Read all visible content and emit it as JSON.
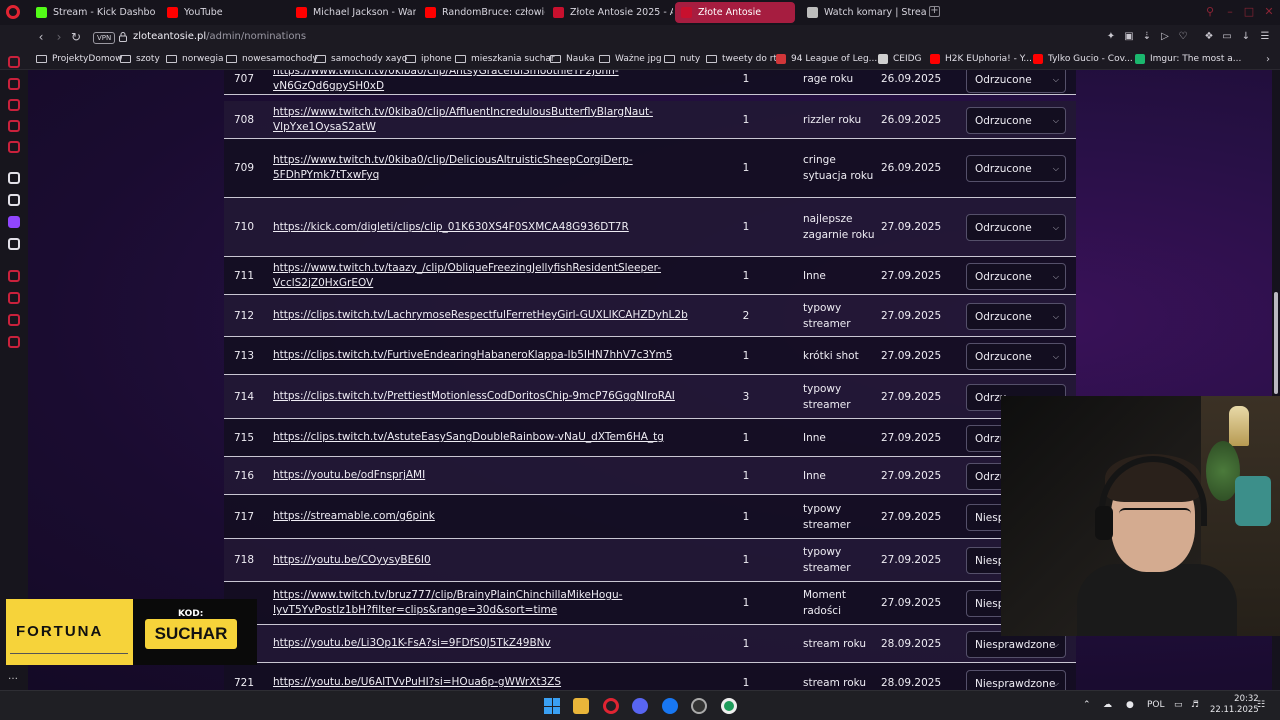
{
  "tabs": [
    {
      "label": "Stream - Kick Dashboard",
      "icon": "kick-icon",
      "color": "#53fc18",
      "active": false
    },
    {
      "label": "YouTube",
      "icon": "youtube-icon",
      "color": "#ff0000",
      "active": false
    },
    {
      "label": "Michael Jackson - Wanna",
      "icon": "youtube-icon",
      "color": "#ff0000",
      "active": false
    },
    {
      "label": "RandomBruce: człowiek -",
      "icon": "youtube-icon",
      "color": "#ff0000",
      "active": false
    },
    {
      "label": "Złote Antosie 2025 - Arkus",
      "icon": "site-icon",
      "color": "#c8102e",
      "active": false
    },
    {
      "label": "Złote Antosie",
      "icon": "site-icon",
      "color": "#c8102e",
      "active": true
    },
    {
      "label": "Watch komary | Streamab",
      "icon": "loading-icon",
      "color": "#bdbdbd",
      "active": false
    }
  ],
  "address": {
    "vpn_label": "VPN",
    "domain": "zloteantosie.pl",
    "path": "/admin/nominations"
  },
  "bookmarks": [
    {
      "label": "ProjektyDomow",
      "type": "folder"
    },
    {
      "label": "szoty",
      "type": "folder"
    },
    {
      "label": "norwegia",
      "type": "folder"
    },
    {
      "label": "nowesamochody",
      "type": "folder"
    },
    {
      "label": "samochody xayo",
      "type": "folder"
    },
    {
      "label": "iphone",
      "type": "folder"
    },
    {
      "label": "mieszkania suchar",
      "type": "folder"
    },
    {
      "label": "Nauka",
      "type": "folder"
    },
    {
      "label": "Ważne jpg",
      "type": "folder"
    },
    {
      "label": "nuty",
      "type": "folder"
    },
    {
      "label": "tweety do rt",
      "type": "folder"
    },
    {
      "label": "94 League of Leg...",
      "type": "site",
      "color": "#d13639"
    },
    {
      "label": "CEIDG",
      "type": "site",
      "color": "#cfcfcf"
    },
    {
      "label": "H2K EUphoria! - Y...",
      "type": "site",
      "color": "#ff0000"
    },
    {
      "label": "Tylko Gucio - Cov...",
      "type": "site",
      "color": "#ff0000"
    },
    {
      "label": "Imgur: The most a...",
      "type": "site",
      "color": "#1bb76e"
    }
  ],
  "nominations": [
    {
      "id": "707",
      "url": "https://www.twitch.tv/0kiba0/clip/AntsyGracefulSmoothieTF2John-vN6GzQd6gpySH0xD",
      "count": "1",
      "category": "rage roku",
      "date": "26.09.2025",
      "status": "Odrzucone"
    },
    {
      "id": "708",
      "url": "https://www.twitch.tv/0kiba0/clip/AffluentIncredulousButterflyBlargNaut-VlpYxe1OysaS2atW",
      "count": "1",
      "category": "rizzler roku",
      "date": "26.09.2025",
      "status": "Odrzucone"
    },
    {
      "id": "709",
      "url": "https://www.twitch.tv/0kiba0/clip/DeliciousAltruisticSheepCorgiDerp-5FDhPYmk7tTxwFyq",
      "count": "1",
      "category": "cringe sytuacja roku",
      "date": "26.09.2025",
      "status": "Odrzucone"
    },
    {
      "id": "710",
      "url": "https://kick.com/digleti/clips/clip_01K630XS4F0SXMCA48G936DT7R",
      "count": "1",
      "category": "najlepsze zagarnie roku",
      "date": "27.09.2025",
      "status": "Odrzucone"
    },
    {
      "id": "711",
      "url": "https://www.twitch.tv/taazy_/clip/ObliqueFreezingJellyfishResidentSleeper-VcclS2jZ0HxGrEOV",
      "count": "1",
      "category": "Inne",
      "date": "27.09.2025",
      "status": "Odrzucone"
    },
    {
      "id": "712",
      "url": "https://clips.twitch.tv/LachrymoseRespectfulFerretHeyGirl-GUXLIKCAHZDyhL2b",
      "count": "2",
      "category": "typowy streamer",
      "date": "27.09.2025",
      "status": "Odrzucone"
    },
    {
      "id": "713",
      "url": "https://clips.twitch.tv/FurtiveEndearingHabaneroKlappa-Ib5IHN7hhV7c3Ym5",
      "count": "1",
      "category": "krótki shot",
      "date": "27.09.2025",
      "status": "Odrzucone"
    },
    {
      "id": "714",
      "url": "https://clips.twitch.tv/PrettiestMotionlessCodDoritosChip-9mcP76GggNIroRAI",
      "count": "3",
      "category": "typowy streamer",
      "date": "27.09.2025",
      "status": "Odrzu"
    },
    {
      "id": "715",
      "url": "https://clips.twitch.tv/AstuteEasySangDoubleRainbow-vNaU_dXTem6HA_tg",
      "count": "1",
      "category": "Inne",
      "date": "27.09.2025",
      "status": "Odrzu"
    },
    {
      "id": "716",
      "url": "https://youtu.be/odFnsprjAMI",
      "count": "1",
      "category": "Inne",
      "date": "27.09.2025",
      "status": "Odrzu"
    },
    {
      "id": "717",
      "url": "https://streamable.com/g6pink",
      "count": "1",
      "category": "typowy streamer",
      "date": "27.09.2025",
      "status": "Niesp"
    },
    {
      "id": "718",
      "url": "https://youtu.be/COyysyBE6I0",
      "count": "1",
      "category": "typowy streamer",
      "date": "27.09.2025",
      "status": "Niesp"
    },
    {
      "id": "",
      "url": "https://www.twitch.tv/bruz777/clip/BrainyPlainChinchillaMikeHogu-IyvT5YvPostIz1bH?filter=clips&range=30d&sort=time",
      "count": "1",
      "category": "Moment radości",
      "date": "27.09.2025",
      "status": "Niesp"
    },
    {
      "id": "",
      "url": "https://youtu.be/Li3Op1K-FsA?si=9FDfS0J5TkZ49BNv",
      "count": "1",
      "category": "stream roku",
      "date": "28.09.2025",
      "status": "Niesprawdzone"
    },
    {
      "id": "721",
      "url": "https://youtu.be/U6AlTVvPuHI?si=HOua6p-gWWrXt3ZS",
      "count": "1",
      "category": "stream roku",
      "date": "28.09.2025",
      "status": "Niesprawdzone"
    }
  ],
  "overlay": {
    "brand": "FORTUNA",
    "kod_label": "KOD:",
    "code": "SUCHAR"
  },
  "taskbar": {
    "language": "POL",
    "time": "20:32",
    "date": "22.11.2025",
    "discord_badge": "99",
    "messenger_badge": "3"
  }
}
